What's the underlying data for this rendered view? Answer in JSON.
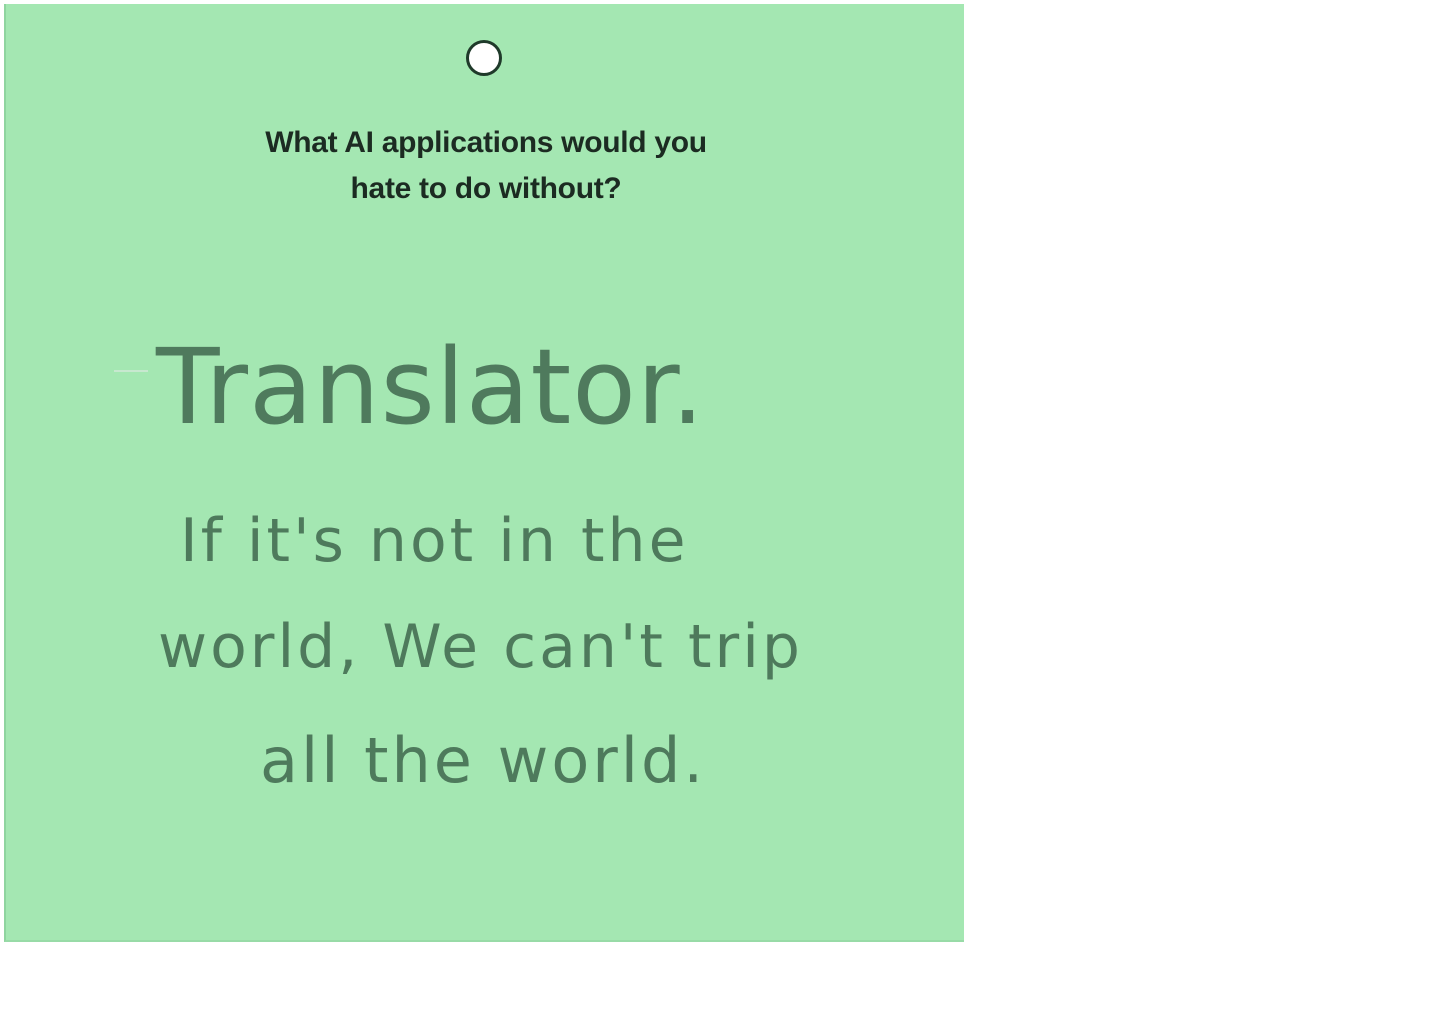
{
  "card": {
    "prompt_line1": "What AI applications would you",
    "prompt_line2": "hate to do without?",
    "handwriting": {
      "title": "Translator.",
      "line1": "If it's not in the",
      "line2": "world, We can't trip",
      "line3": "all the world."
    },
    "colors": {
      "card_background": "#a4e7b2",
      "prompt_text": "#1c2b22",
      "handwriting_ink": "#4e7a5c"
    }
  }
}
